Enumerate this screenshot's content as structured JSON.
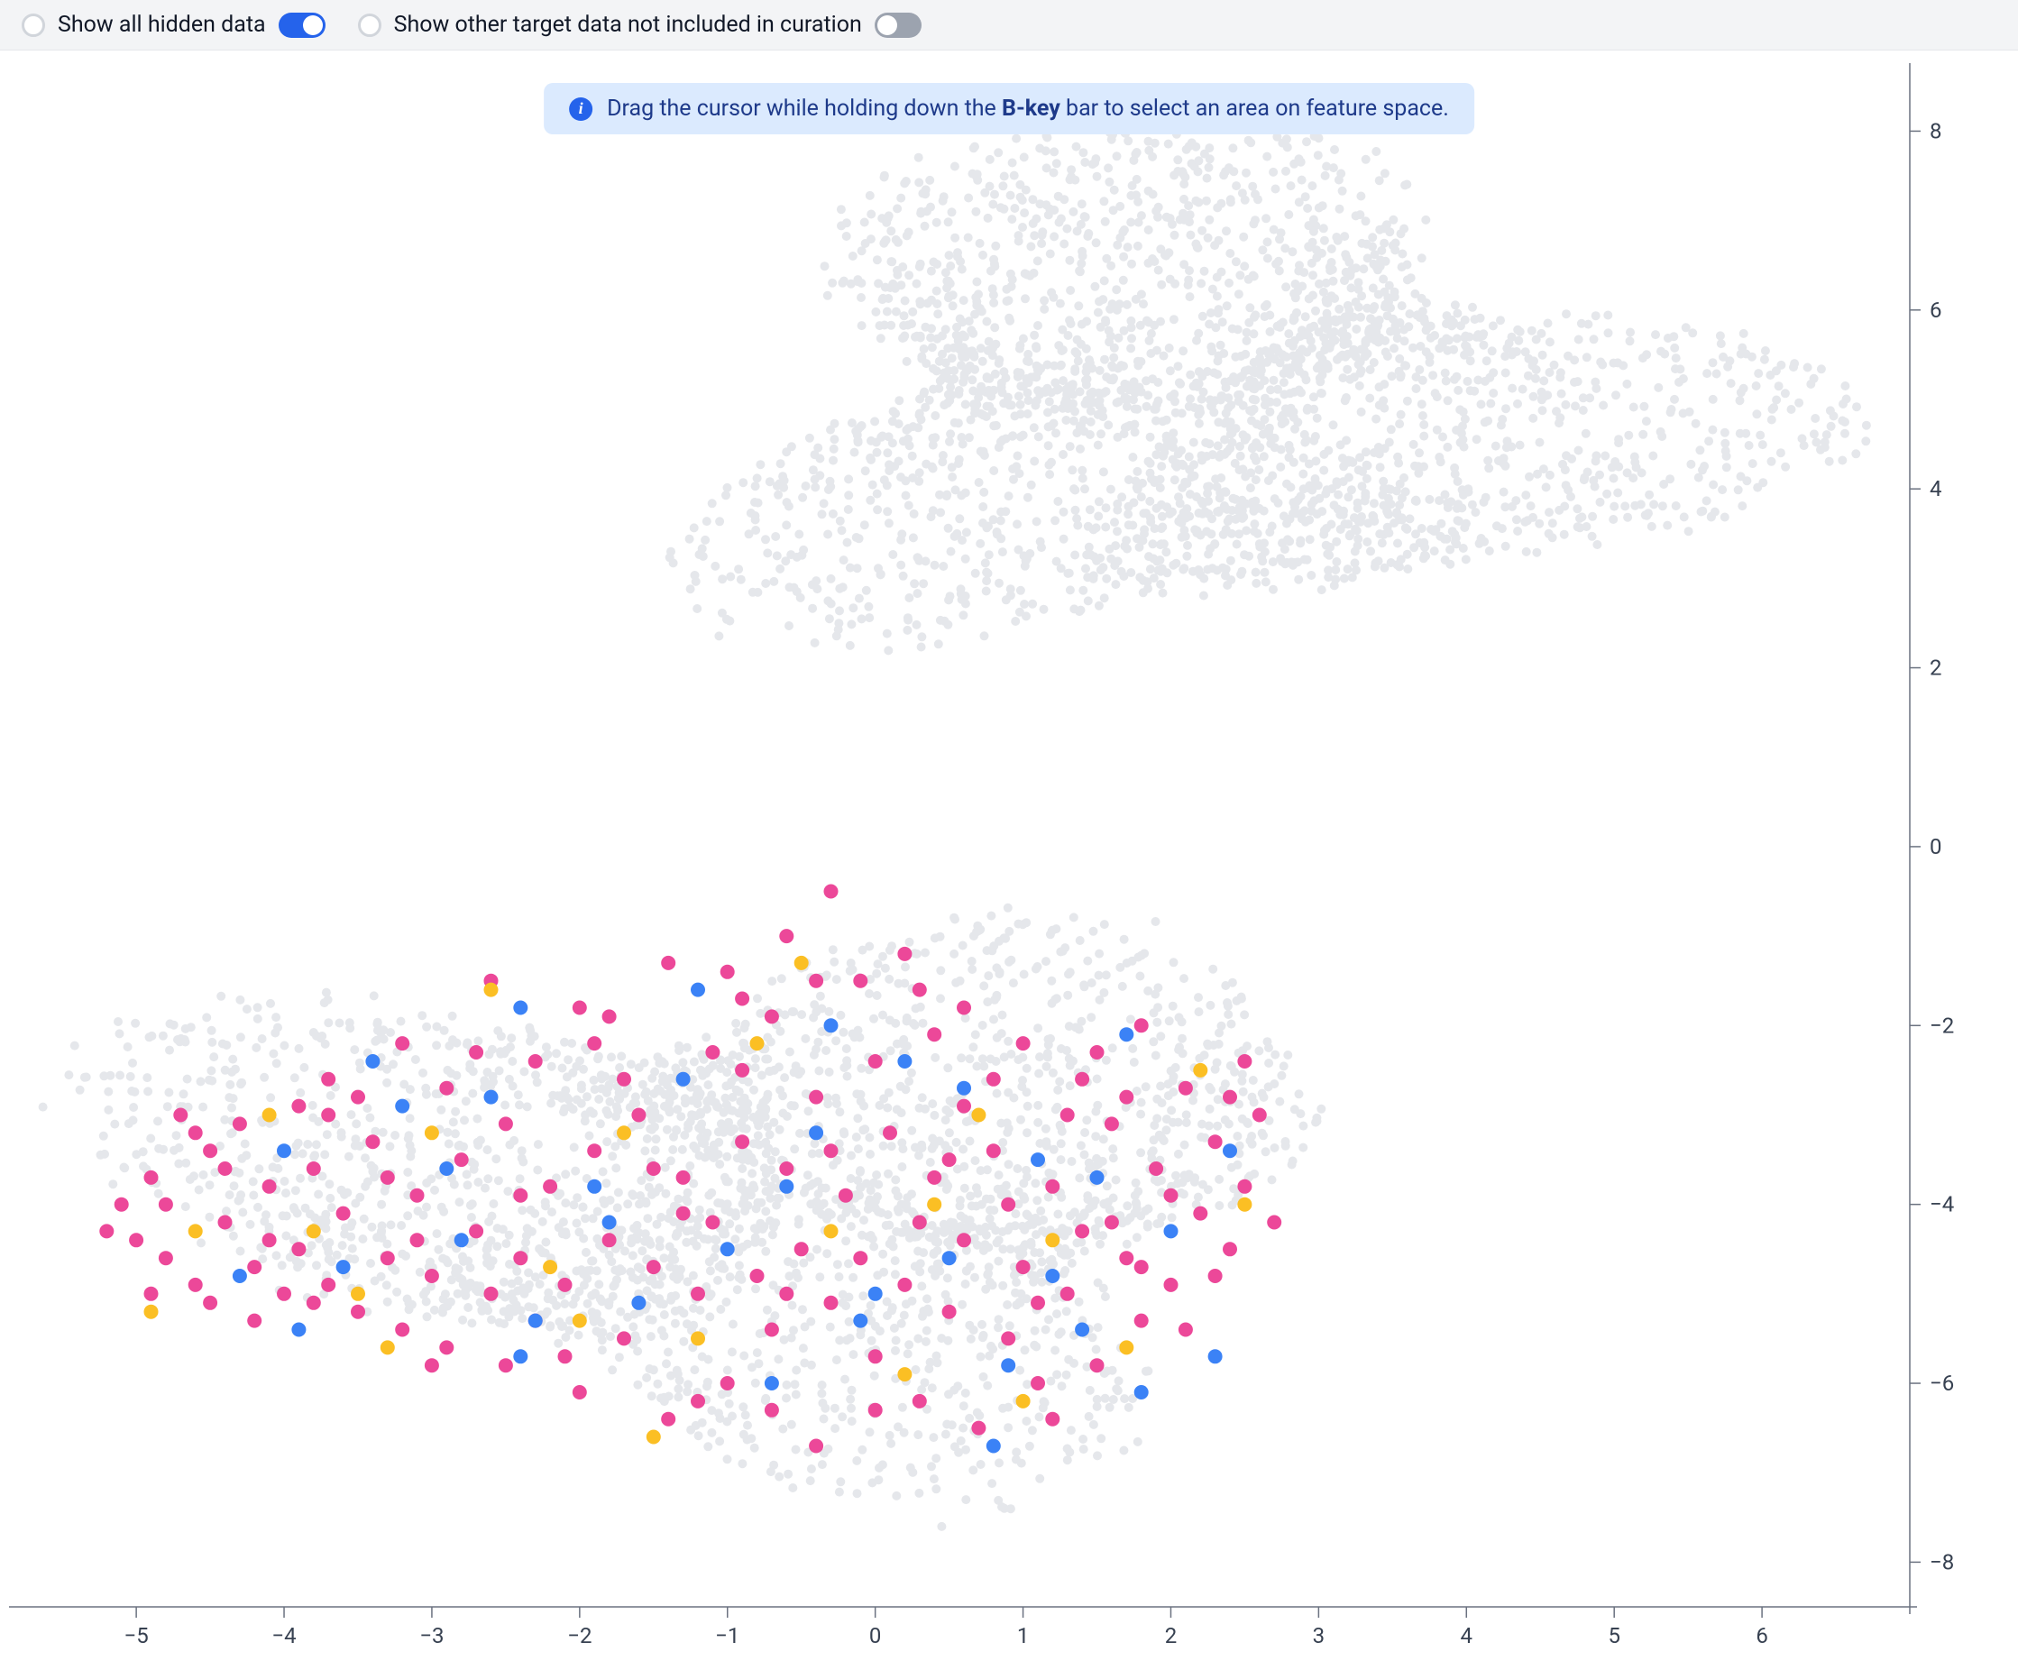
{
  "toolbar": {
    "toggle1": {
      "label": "Show all hidden data",
      "on": true
    },
    "toggle2": {
      "label": "Show other target data not included in curation",
      "on": false
    }
  },
  "banner": {
    "pre": "Drag the cursor while holding down the ",
    "bold": "B-key",
    "post": " bar to select an area on feature space."
  },
  "chart_data": {
    "type": "scatter",
    "title": "",
    "xlabel": "",
    "ylabel": "",
    "xlim": [
      -5.8,
      7.0
    ],
    "ylim": [
      -8.5,
      8.7
    ],
    "x_ticks": [
      -5,
      -4,
      -3,
      -2,
      -1,
      0,
      1,
      2,
      3,
      4,
      5,
      6
    ],
    "y_ticks": [
      -8,
      -6,
      -4,
      -2,
      0,
      2,
      4,
      6,
      8
    ],
    "series": [
      {
        "name": "hidden-background",
        "color": "#e5e7eb",
        "marker": "circle",
        "size": 5,
        "clusters": [
          {
            "cx": 2.3,
            "cy": 5.0,
            "rx": 3.6,
            "ry": 3.0,
            "count": 2600
          },
          {
            "cx": -0.8,
            "cy": -3.8,
            "rx": 4.3,
            "ry": 3.0,
            "count": 2600
          }
        ]
      },
      {
        "name": "pink",
        "color": "#ec4899",
        "marker": "circle",
        "size": 8,
        "points": [
          [
            -5.1,
            -4.0
          ],
          [
            -5.0,
            -4.4
          ],
          [
            -4.9,
            -3.7
          ],
          [
            -4.8,
            -4.6
          ],
          [
            -4.7,
            -3.0
          ],
          [
            -4.6,
            -4.9
          ],
          [
            -4.5,
            -3.4
          ],
          [
            -4.5,
            -5.1
          ],
          [
            -4.4,
            -4.2
          ],
          [
            -4.3,
            -3.1
          ],
          [
            -4.2,
            -4.7
          ],
          [
            -4.1,
            -3.8
          ],
          [
            -4.0,
            -5.0
          ],
          [
            -3.9,
            -2.9
          ],
          [
            -3.9,
            -4.5
          ],
          [
            -3.8,
            -3.6
          ],
          [
            -3.7,
            -4.9
          ],
          [
            -3.7,
            -2.6
          ],
          [
            -3.6,
            -4.1
          ],
          [
            -3.5,
            -5.2
          ],
          [
            -3.4,
            -3.3
          ],
          [
            -3.3,
            -4.6
          ],
          [
            -3.2,
            -2.2
          ],
          [
            -3.2,
            -5.4
          ],
          [
            -3.1,
            -3.9
          ],
          [
            -3.0,
            -4.8
          ],
          [
            -2.9,
            -2.7
          ],
          [
            -2.9,
            -5.6
          ],
          [
            -2.8,
            -3.5
          ],
          [
            -2.7,
            -4.3
          ],
          [
            -2.6,
            -1.5
          ],
          [
            -2.6,
            -5.0
          ],
          [
            -2.5,
            -3.1
          ],
          [
            -2.4,
            -4.6
          ],
          [
            -2.3,
            -2.4
          ],
          [
            -2.3,
            -5.3
          ],
          [
            -2.2,
            -3.8
          ],
          [
            -2.1,
            -4.9
          ],
          [
            -2.0,
            -1.8
          ],
          [
            -2.0,
            -6.1
          ],
          [
            -1.9,
            -3.4
          ],
          [
            -1.8,
            -4.4
          ],
          [
            -1.7,
            -2.6
          ],
          [
            -1.7,
            -5.5
          ],
          [
            -1.6,
            -3.0
          ],
          [
            -1.5,
            -4.7
          ],
          [
            -1.4,
            -1.3
          ],
          [
            -1.4,
            -6.4
          ],
          [
            -1.3,
            -3.7
          ],
          [
            -1.2,
            -5.0
          ],
          [
            -1.1,
            -2.3
          ],
          [
            -1.1,
            -4.2
          ],
          [
            -1.0,
            -6.0
          ],
          [
            -0.9,
            -3.3
          ],
          [
            -0.8,
            -4.8
          ],
          [
            -0.7,
            -1.9
          ],
          [
            -0.7,
            -5.4
          ],
          [
            -0.6,
            -3.6
          ],
          [
            -0.5,
            -4.5
          ],
          [
            -0.4,
            -2.8
          ],
          [
            -0.4,
            -6.7
          ],
          [
            -0.3,
            -0.5
          ],
          [
            -0.3,
            -5.1
          ],
          [
            -0.2,
            -3.9
          ],
          [
            -0.1,
            -4.6
          ],
          [
            0.0,
            -2.4
          ],
          [
            0.0,
            -5.7
          ],
          [
            0.1,
            -3.2
          ],
          [
            0.2,
            -4.9
          ],
          [
            0.3,
            -1.6
          ],
          [
            0.3,
            -6.2
          ],
          [
            0.4,
            -3.7
          ],
          [
            0.5,
            -5.2
          ],
          [
            0.6,
            -2.9
          ],
          [
            0.6,
            -4.4
          ],
          [
            0.7,
            -6.5
          ],
          [
            0.8,
            -3.4
          ],
          [
            0.9,
            -5.5
          ],
          [
            1.0,
            -2.2
          ],
          [
            1.0,
            -4.7
          ],
          [
            1.1,
            -6.0
          ],
          [
            1.2,
            -3.8
          ],
          [
            1.3,
            -5.0
          ],
          [
            1.4,
            -2.6
          ],
          [
            1.4,
            -4.3
          ],
          [
            1.5,
            -5.8
          ],
          [
            1.6,
            -3.1
          ],
          [
            1.7,
            -4.6
          ],
          [
            1.8,
            -2.0
          ],
          [
            1.8,
            -5.3
          ],
          [
            1.9,
            -3.6
          ],
          [
            2.0,
            -4.9
          ],
          [
            2.1,
            -2.7
          ],
          [
            2.2,
            -4.1
          ],
          [
            2.3,
            -3.3
          ],
          [
            2.4,
            -4.5
          ],
          [
            2.5,
            -2.4
          ],
          [
            2.5,
            -3.8
          ],
          [
            2.6,
            -3.0
          ],
          [
            2.7,
            -4.2
          ],
          [
            -4.8,
            -4.0
          ],
          [
            -4.4,
            -3.6
          ],
          [
            -4.1,
            -4.4
          ],
          [
            -3.8,
            -5.1
          ],
          [
            -3.5,
            -2.8
          ],
          [
            -3.3,
            -3.7
          ],
          [
            -3.0,
            -5.8
          ],
          [
            -2.7,
            -2.3
          ],
          [
            -2.4,
            -3.9
          ],
          [
            -2.1,
            -5.7
          ],
          [
            -1.8,
            -1.9
          ],
          [
            -1.5,
            -3.6
          ],
          [
            -1.2,
            -6.2
          ],
          [
            -0.9,
            -2.5
          ],
          [
            -0.6,
            -5.0
          ],
          [
            -0.3,
            -3.4
          ],
          [
            0.0,
            -6.3
          ],
          [
            0.3,
            -4.2
          ],
          [
            0.6,
            -1.8
          ],
          [
            0.9,
            -4.0
          ],
          [
            1.2,
            -6.4
          ],
          [
            1.5,
            -2.3
          ],
          [
            1.8,
            -4.7
          ],
          [
            2.1,
            -5.4
          ],
          [
            2.4,
            -2.8
          ],
          [
            -4.6,
            -3.2
          ],
          [
            -4.2,
            -5.3
          ],
          [
            -3.7,
            -3.0
          ],
          [
            -3.1,
            -4.4
          ],
          [
            -2.5,
            -5.8
          ],
          [
            -1.9,
            -2.2
          ],
          [
            -1.3,
            -4.1
          ],
          [
            -0.7,
            -6.3
          ],
          [
            -0.1,
            -1.5
          ],
          [
            0.5,
            -3.5
          ],
          [
            1.1,
            -5.1
          ],
          [
            1.7,
            -2.8
          ],
          [
            2.3,
            -4.8
          ],
          [
            -5.2,
            -4.3
          ],
          [
            -4.9,
            -5.0
          ],
          [
            -0.6,
            -1.0
          ],
          [
            -0.4,
            -1.5
          ],
          [
            -0.9,
            -1.7
          ],
          [
            0.2,
            -1.2
          ],
          [
            -1.0,
            -1.4
          ],
          [
            1.6,
            -4.2
          ],
          [
            2.0,
            -3.9
          ],
          [
            1.3,
            -3.0
          ],
          [
            0.8,
            -2.6
          ],
          [
            0.4,
            -2.1
          ]
        ]
      },
      {
        "name": "blue",
        "color": "#3b82f6",
        "marker": "circle",
        "size": 8,
        "points": [
          [
            -4.0,
            -3.4
          ],
          [
            -3.6,
            -4.7
          ],
          [
            -3.2,
            -2.9
          ],
          [
            -2.8,
            -4.4
          ],
          [
            -2.4,
            -1.8
          ],
          [
            -2.3,
            -5.3
          ],
          [
            -1.9,
            -3.8
          ],
          [
            -1.6,
            -5.1
          ],
          [
            -1.3,
            -2.6
          ],
          [
            -1.0,
            -4.5
          ],
          [
            -0.7,
            -6.0
          ],
          [
            -0.4,
            -3.2
          ],
          [
            -0.1,
            -5.3
          ],
          [
            0.2,
            -2.4
          ],
          [
            0.5,
            -4.6
          ],
          [
            0.8,
            -6.7
          ],
          [
            1.1,
            -3.5
          ],
          [
            1.4,
            -5.4
          ],
          [
            1.7,
            -2.1
          ],
          [
            2.0,
            -4.3
          ],
          [
            2.3,
            -5.7
          ],
          [
            -3.9,
            -5.4
          ],
          [
            -3.4,
            -2.4
          ],
          [
            -2.9,
            -3.6
          ],
          [
            -2.4,
            -5.7
          ],
          [
            -1.8,
            -4.2
          ],
          [
            -1.2,
            -1.6
          ],
          [
            -0.6,
            -3.8
          ],
          [
            0.0,
            -5.0
          ],
          [
            0.6,
            -2.7
          ],
          [
            1.2,
            -4.8
          ],
          [
            1.8,
            -6.1
          ],
          [
            2.4,
            -3.4
          ],
          [
            -4.3,
            -4.8
          ],
          [
            -0.3,
            -2.0
          ],
          [
            1.5,
            -3.7
          ],
          [
            -2.6,
            -2.8
          ],
          [
            0.9,
            -5.8
          ]
        ]
      },
      {
        "name": "yellow",
        "color": "#fbbf24",
        "marker": "circle",
        "size": 8,
        "points": [
          [
            -4.6,
            -4.3
          ],
          [
            -4.1,
            -3.0
          ],
          [
            -3.5,
            -5.0
          ],
          [
            -3.0,
            -3.2
          ],
          [
            -2.6,
            -1.6
          ],
          [
            -2.2,
            -4.7
          ],
          [
            -1.7,
            -3.2
          ],
          [
            -1.2,
            -5.5
          ],
          [
            -0.8,
            -2.2
          ],
          [
            -0.3,
            -4.3
          ],
          [
            0.2,
            -5.9
          ],
          [
            0.7,
            -3.0
          ],
          [
            1.2,
            -4.4
          ],
          [
            1.7,
            -5.6
          ],
          [
            2.2,
            -2.5
          ],
          [
            -3.8,
            -4.3
          ],
          [
            -2.0,
            -5.3
          ],
          [
            -0.5,
            -1.3
          ],
          [
            1.0,
            -6.2
          ],
          [
            2.5,
            -4.0
          ],
          [
            -4.9,
            -5.2
          ],
          [
            -1.5,
            -6.6
          ],
          [
            0.4,
            -4.0
          ],
          [
            -3.3,
            -5.6
          ]
        ]
      }
    ]
  }
}
